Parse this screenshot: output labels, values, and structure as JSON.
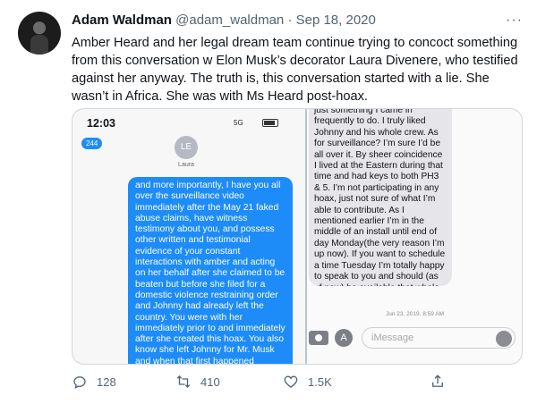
{
  "tweet": {
    "author_name": "Adam Waldman",
    "handle": "@adam_waldman",
    "sep": "·",
    "date": "Sep 18, 2020",
    "text": "Amber Heard and her legal dream team continue trying to concoct something from this conversation w Elon Musk’s decorator Laura Divenere, who testified against her anyway. The truth is, this conversation started with a lie. She wasn’t in Africa. She was with Ms Heard post-hoax."
  },
  "left_phone": {
    "time": "12:03",
    "signal": "5G",
    "badge": "244",
    "contact_initials": "LE",
    "contact_name": "Laura",
    "message": "and more importantly, I  have you all over the surveillance video immediately after the May 21 faked abuse claims, have witness testimony about you, and possess other written and testimonial evidence of your constant interactions with amber and acting on her behalf after she claimed to be beaten but before she filed for a domestic violence restraining order and Johnny had already left the country. You were with her immediately prior to and immediately after she created this hoax. You also know she left Johnny for Mr. Musk and when that first happened (although as a local"
  },
  "right_phone": {
    "message": "just  something I came in frequently to do. I truly liked Johnny and his whole crew.   As for surveillance?  I’m sure I’d be all over it.  By sheer coincidence I lived at the Eastern during that time and had keys to both PH3 & 5.  I’m not participating in any hoax, just not sure of what I’m able to contribute.  As I mentioned earlier I’m in the middle of an install until end of day Monday(the very reason I’m up now). If you want to schedule a time Tuesday I’m totally happy to speak to you and should (as of now) be available that whole morning albeit a little tired.",
    "timestamp": "Jun 23, 2019, 8:59 AM",
    "input_placeholder": "iMessage"
  },
  "actions": {
    "replies": "128",
    "retweets": "410",
    "likes": "1.5K"
  },
  "colors": {
    "imessage_blue": "#1d8cf8",
    "muted": "#536471"
  }
}
